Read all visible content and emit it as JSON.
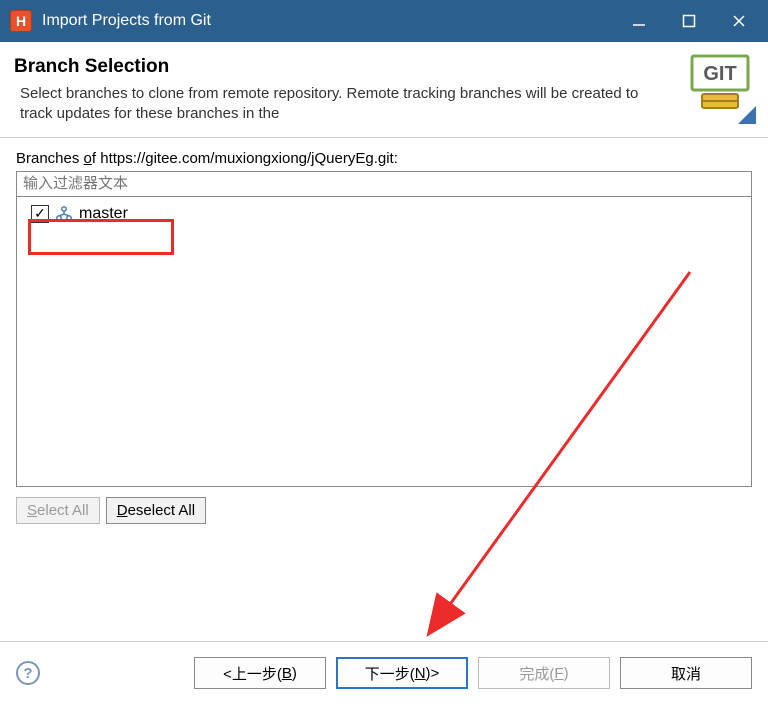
{
  "window": {
    "title": "Import Projects from Git"
  },
  "header": {
    "title": "Branch Selection",
    "description": "Select branches to clone from remote repository. Remote tracking branches will be created to track updates for these branches in the"
  },
  "branches": {
    "label_prefix": "Branches ",
    "label_underlined": "o",
    "label_suffix": "f https://gitee.com/muxiongxiong/jQueryEg.git:",
    "filter_placeholder": "输入过滤器文本",
    "items": [
      {
        "name": "master",
        "checked": true
      }
    ]
  },
  "buttons": {
    "select_all_underlined": "S",
    "select_all_rest": "elect All",
    "deselect_all_underlined": "D",
    "deselect_all_rest": "eselect All"
  },
  "footer": {
    "back_pre": "<上一步(",
    "back_u": "B",
    "back_post": ")",
    "next_pre": "下一步(",
    "next_u": "N",
    "next_post": ")>",
    "finish_pre": "完成(",
    "finish_u": "F",
    "finish_post": ")",
    "cancel": "取消"
  }
}
